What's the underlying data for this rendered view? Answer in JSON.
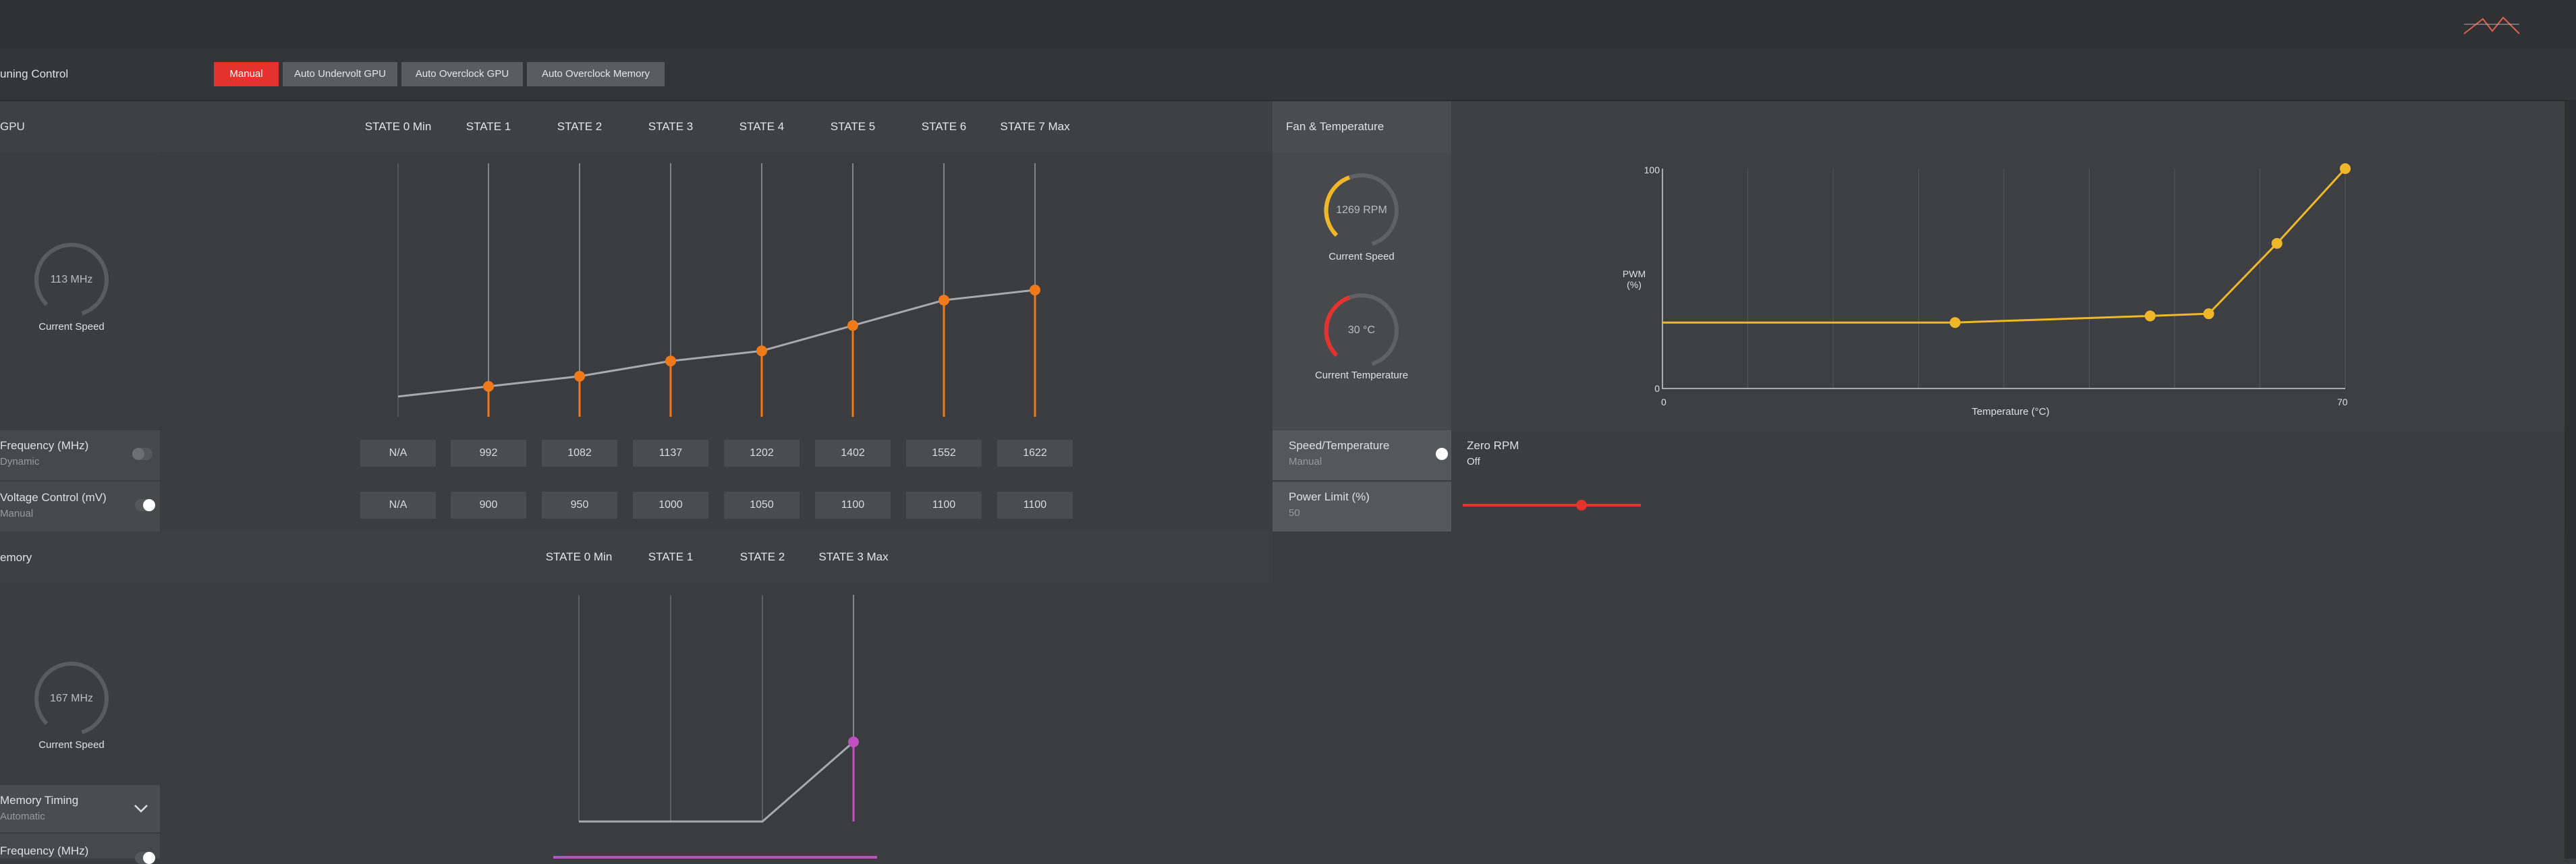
{
  "tuning": {
    "label": "uning Control",
    "tabs": [
      "Manual",
      "Auto Undervolt GPU",
      "Auto Overclock GPU",
      "Auto Overclock Memory"
    ]
  },
  "gpu": {
    "label": "GPU",
    "state_headers": [
      "STATE 0 Min",
      "STATE 1",
      "STATE 2",
      "STATE 3",
      "STATE 4",
      "STATE 5",
      "STATE 6",
      "STATE 7 Max"
    ],
    "gauge_value": "113 MHz",
    "gauge_caption": "Current Speed",
    "frequency": {
      "label": "Frequency (MHz)",
      "mode": "Dynamic",
      "values": [
        "N/A",
        "992",
        "1082",
        "1137",
        "1202",
        "1402",
        "1552",
        "1622"
      ]
    },
    "voltage": {
      "label": "Voltage Control (mV)",
      "mode": "Manual",
      "values": [
        "N/A",
        "900",
        "950",
        "1000",
        "1050",
        "1100",
        "1100",
        "1100"
      ]
    },
    "curve_points": [
      0.08,
      0.12,
      0.16,
      0.22,
      0.26,
      0.36,
      0.46,
      0.5
    ]
  },
  "fan": {
    "label": "Fan & Temperature",
    "speed_value": "1269 RPM",
    "speed_caption": "Current Speed",
    "temp_value": "30 °C",
    "temp_caption": "Current Temperature",
    "speed_temp": {
      "label": "Speed/Temperature",
      "mode": "Manual"
    },
    "zero_rpm": {
      "label": "Zero RPM",
      "value": "Off"
    },
    "power_limit": {
      "label": "Power Limit (%)",
      "value": "50",
      "fraction": 0.82
    },
    "chart": {
      "ylabel": "PWM\n(%)",
      "xlabel": "Temperature (°C)",
      "y_max": "100",
      "y_min": "0",
      "x_min": "0",
      "x_max": "70",
      "colors": {
        "line": "#f0b829"
      }
    }
  },
  "memory": {
    "label": "emory",
    "state_headers": [
      "STATE 0 Min",
      "STATE 1",
      "STATE 2",
      "STATE 3 Max"
    ],
    "gauge_value": "167 MHz",
    "gauge_caption": "Current Speed",
    "timing": {
      "label": "Memory Timing",
      "mode": "Automatic"
    },
    "frequency": {
      "label": "Frequency (MHz)"
    }
  },
  "chart_data": {
    "type": "line",
    "title": "",
    "xlabel": "Temperature (°C)",
    "ylabel": "PWM (%)",
    "xlim": [
      0,
      70
    ],
    "ylim": [
      0,
      100
    ],
    "series": [
      {
        "x": [
          0,
          30,
          50,
          56,
          63,
          70
        ],
        "y": [
          30,
          30,
          33,
          34,
          66,
          100
        ]
      }
    ]
  }
}
